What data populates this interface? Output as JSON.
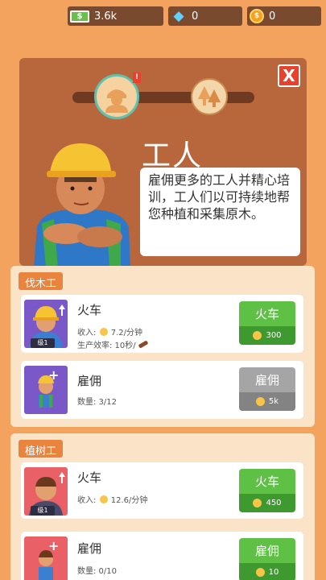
{
  "currency": {
    "cash": "3.6k",
    "gems": "0",
    "coins": "0"
  },
  "header": {
    "title": "工人",
    "description": "雇佣更多的工人并精心培训，工人们以可持续地帮您种植和采集原木。",
    "close_label": "X",
    "alert_mark": "!"
  },
  "sections": [
    {
      "label": "伐木工",
      "cards": [
        {
          "title": "火车",
          "line1_prefix": "收入:",
          "line1_value": "7.2/分钟",
          "line2": "生产效率: 10秒/",
          "level": "级1",
          "button_label": "火车",
          "button_cost": "300"
        },
        {
          "title": "雇佣",
          "line1": "数量: 3/12",
          "button_label": "雇佣",
          "button_cost": "5k"
        }
      ]
    },
    {
      "label": "植树工",
      "cards": [
        {
          "title": "火车",
          "line1_prefix": "收入:",
          "line1_value": "12.6/分钟",
          "level": "级1",
          "button_label": "火车",
          "button_cost": "450"
        },
        {
          "title": "雇佣",
          "line1": "数量: 0/10",
          "button_label": "雇佣",
          "button_cost": "10"
        }
      ]
    }
  ],
  "icons": {
    "cash": "cash-icon",
    "gem": "gem-icon",
    "coin": "coin-icon",
    "worker": "worker-portrait-icon",
    "trees": "trees-icon"
  },
  "colors": {
    "background": "#f4a35f",
    "header_panel": "#b8663c",
    "primary_button": "#5fc046",
    "disabled_button": "#a5a5a5",
    "close_button": "#e8412e"
  }
}
